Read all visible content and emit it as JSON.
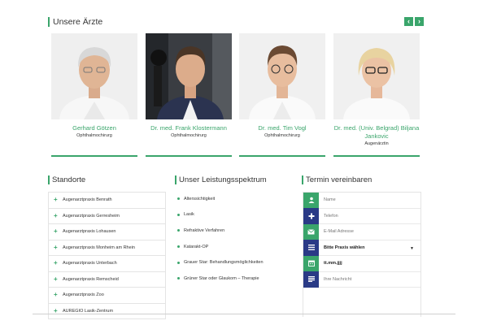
{
  "doctors": {
    "title": "Unsere Ärzte",
    "prev_icon": "chevron-left-icon",
    "next_icon": "chevron-right-icon",
    "items": [
      {
        "name": "Gerhard Götzen",
        "role": "Ophthalmochirurg"
      },
      {
        "name": "Dr. med. Frank Klostermann",
        "role": "Ophthalmochirurg"
      },
      {
        "name": "Dr. med. Tim Vogl",
        "role": "Ophthalmochirurg"
      },
      {
        "name": "Dr. med. (Univ. Belgrad) Biljana Jankovic",
        "role": "Augenärztin"
      }
    ]
  },
  "locations": {
    "title": "Standorte",
    "items": [
      "Augenarztpraxis Benrath",
      "Augenarztpraxis Gerresheim",
      "Augenarztpraxis Lohausen",
      "Augenarztpraxis Monheim am Rhein",
      "Augenarztpraxis Unterbach",
      "Augenarztpraxis Remscheid",
      "Augenarztpraxis Zoo",
      "AUREGIO Lasik-Zentrum"
    ]
  },
  "services": {
    "title": "Unser Leistungsspektrum",
    "items": [
      "Alterssichtigkeit",
      "Lasik",
      "Refraktive Verfahren",
      "Katarakt-OP",
      "Grauer Star: Behandlungsmöglichkeiten",
      "Grüner Star oder Glaukom – Therapie"
    ]
  },
  "booking": {
    "title": "Termin vereinbaren",
    "fields": [
      {
        "icon": "user-icon",
        "placeholder": "Name"
      },
      {
        "icon": "phone-icon",
        "placeholder": "Telefon"
      },
      {
        "icon": "envelope-icon",
        "placeholder": "E-Mail Adresse"
      },
      {
        "icon": "list-icon",
        "value": "Bitte Praxis wählen"
      },
      {
        "icon": "calendar-icon",
        "value": "tt.mm.jjjj"
      },
      {
        "icon": "message-icon",
        "placeholder": "Ihre Nachricht"
      }
    ]
  },
  "colors": {
    "accent": "#3aa56b",
    "navy": "#2a3a86"
  }
}
